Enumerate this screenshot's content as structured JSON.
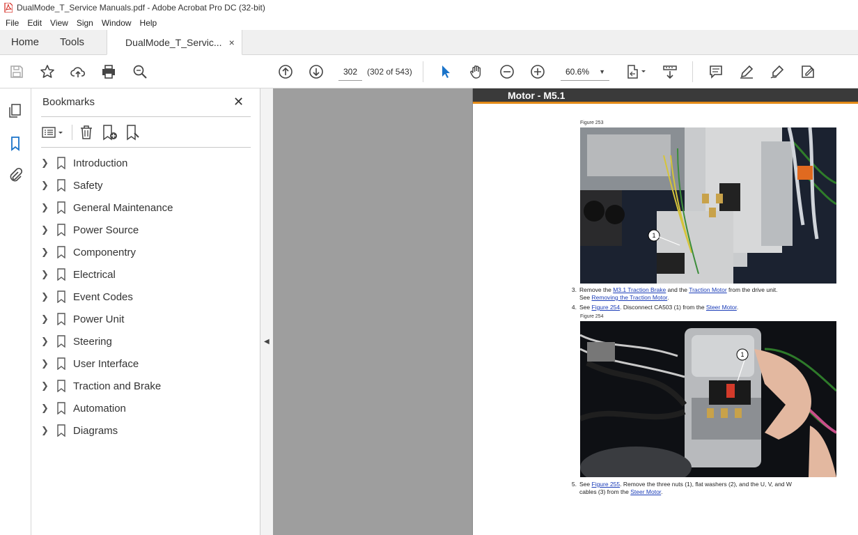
{
  "window": {
    "title": "DualMode_T_Service Manuals.pdf - Adobe Acrobat Pro DC (32-bit)"
  },
  "menu": [
    "File",
    "Edit",
    "View",
    "Sign",
    "Window",
    "Help"
  ],
  "tabs": {
    "home": "Home",
    "tools": "Tools",
    "document": "DualMode_T_Servic...",
    "close": "×"
  },
  "toolbar": {
    "page_number": "302",
    "page_count": "(302 of 543)",
    "zoom": "60.6%",
    "zoom_dropdown": "▼"
  },
  "bookmarks": {
    "title": "Bookmarks",
    "close": "✕",
    "items": [
      {
        "label": "Introduction"
      },
      {
        "label": "Safety"
      },
      {
        "label": "General Maintenance"
      },
      {
        "label": "Power Source"
      },
      {
        "label": "Componentry"
      },
      {
        "label": "Electrical"
      },
      {
        "label": "Event Codes"
      },
      {
        "label": "Power Unit"
      },
      {
        "label": "Steering"
      },
      {
        "label": "User Interface"
      },
      {
        "label": "Traction and Brake"
      },
      {
        "label": "Automation"
      },
      {
        "label": "Diagrams"
      }
    ]
  },
  "document": {
    "header": "Motor - M5.1",
    "figure_253": "Figure 253",
    "figure_254": "Figure 254",
    "callout": "1",
    "step3": {
      "num": "3.",
      "t1": "Remove the ",
      "l1": "M3.1 Traction Brake",
      "t2": " and the ",
      "l2": "Traction Motor",
      "t3": " from the drive unit.",
      "t4": "See ",
      "l3": "Removing the Traction Motor",
      "t5": "."
    },
    "step4": {
      "num": "4.",
      "t1": "See ",
      "l1": "Figure 254",
      "t2": ". Disconnect CA503 (1) from the ",
      "l2": "Steer Motor",
      "t3": "."
    },
    "step5": {
      "num": "5.",
      "t1": "See ",
      "l1": "Figure 255",
      "t2": ". Remove the three nuts (1), flat washers (2), and the U, V, and W",
      "t3": "cables (3) from the ",
      "l2": "Steer Motor",
      "t4": "."
    }
  }
}
